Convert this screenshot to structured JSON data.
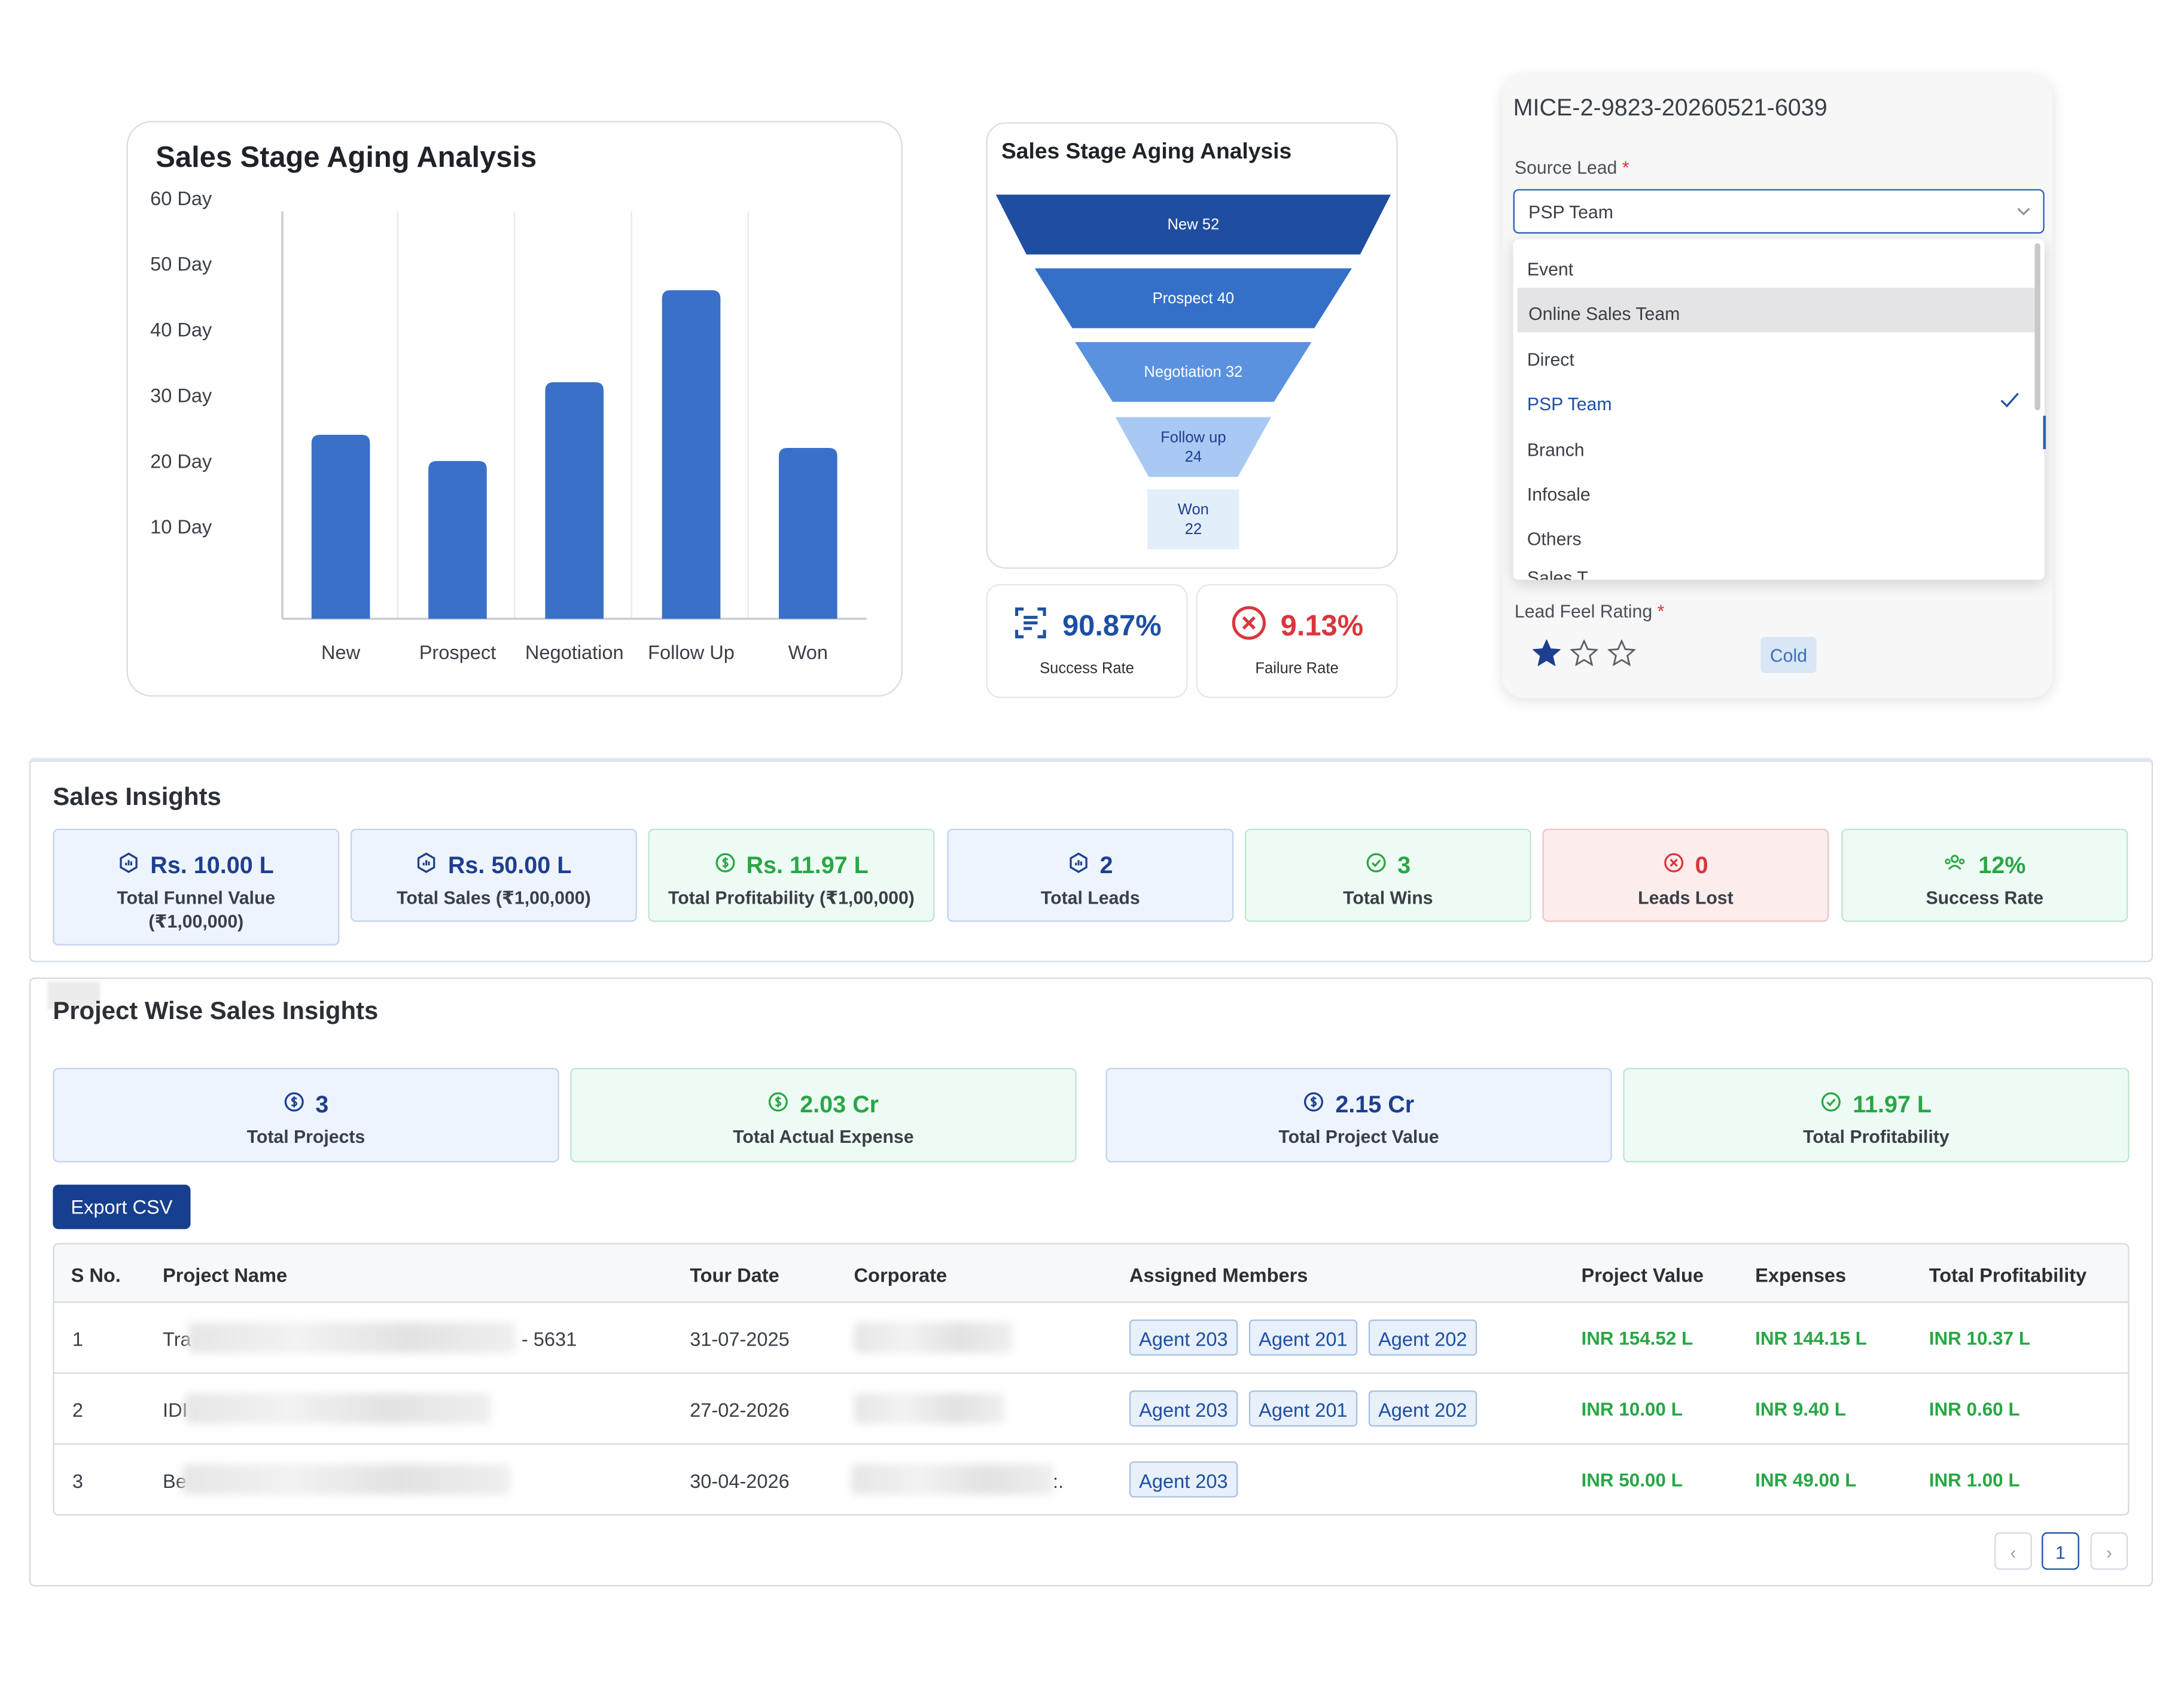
{
  "bar_chart": {
    "title": "Sales Stage Aging Analysis",
    "chart_data": {
      "type": "bar",
      "categories": [
        "New",
        "Prospect",
        "Negotiation",
        "Follow Up",
        "Won"
      ],
      "values": [
        28,
        24,
        36,
        50,
        26
      ],
      "ytick_labels": [
        "10 Day",
        "20 Day",
        "30 Day",
        "40 Day",
        "50 Day",
        "60 Day"
      ],
      "ylim": [
        0,
        62
      ],
      "grid": "vertical",
      "color": "#3a70c8"
    }
  },
  "funnel": {
    "title": "Sales Stage Aging Analysis",
    "chart_data": {
      "type": "funnel",
      "stages": [
        {
          "label": "New 52",
          "lines": [
            "New 52"
          ],
          "value": 52,
          "color": "#1f4ea0",
          "text_color": "#ffffff"
        },
        {
          "label": "Prospect 40",
          "lines": [
            "Prospect 40"
          ],
          "value": 40,
          "color": "#3470c8",
          "text_color": "#ffffff"
        },
        {
          "label": "Negotiation 32",
          "lines": [
            "Negotiation 32"
          ],
          "value": 32,
          "color": "#5b92e0",
          "text_color": "#ffffff"
        },
        {
          "label": "Follow up 24",
          "lines": [
            "Follow up",
            "24"
          ],
          "value": 24,
          "color": "#a9c9f4",
          "text_color": "#1d3f8f"
        },
        {
          "label": "Won 22",
          "lines": [
            "Won",
            "22"
          ],
          "value": 22,
          "color": "#e3eefb",
          "text_color": "#1d3f8f"
        }
      ]
    }
  },
  "rates": {
    "success": {
      "value": "90.87%",
      "label": "Success Rate",
      "icon": "document-list-icon",
      "color": "#1d4fa3"
    },
    "failure": {
      "value": "9.13%",
      "label": "Failure Rate",
      "icon": "x-circle-icon",
      "color": "#d9363e"
    }
  },
  "lead_form": {
    "lead_id": "MICE-2-9823-20260521-6039",
    "source_label": "Source Lead",
    "required_mark": "*",
    "selected": "PSP Team",
    "options": [
      "Event",
      "Online Sales Team",
      "Direct",
      "PSP Team",
      "Branch",
      "Infosale",
      "Others"
    ],
    "hovered_option": "Online Sales Team",
    "cut_option": "Sales T...",
    "rating_label": "Lead Feel Rating",
    "rating": 1,
    "rating_max": 3,
    "rating_badge": "Cold"
  },
  "sales_insights": {
    "title": "Sales Insights",
    "stats": [
      {
        "value": "Rs. 10.00 L",
        "label": "Total Funnel Value (₹1,00,000)",
        "icon": "hexagon-chart-icon",
        "tone": "blue"
      },
      {
        "value": "Rs. 50.00 L",
        "label": "Total Sales (₹1,00,000)",
        "icon": "hexagon-chart-icon",
        "tone": "blue"
      },
      {
        "value": "Rs. 11.97 L",
        "label": "Total Profitability (₹1,00,000)",
        "icon": "dollar-circle-icon",
        "tone": "green"
      },
      {
        "value": "2",
        "label": "Total Leads",
        "icon": "hexagon-chart-icon",
        "tone": "blue"
      },
      {
        "value": "3",
        "label": "Total Wins",
        "icon": "check-circle-icon",
        "tone": "green"
      },
      {
        "value": "0",
        "label": "Leads Lost",
        "icon": "x-circle-icon",
        "tone": "red"
      },
      {
        "value": "12%",
        "label": "Success Rate",
        "icon": "users-icon",
        "tone": "green"
      }
    ]
  },
  "project_insights": {
    "title": "Project Wise Sales Insights",
    "stats": [
      {
        "value": "3",
        "label": "Total Projects",
        "icon": "dollar-circle-icon",
        "tone": "blue"
      },
      {
        "value": "2.03 Cr",
        "label": "Total Actual Expense",
        "icon": "dollar-circle-icon",
        "tone": "green"
      },
      {
        "value": "2.15 Cr",
        "label": "Total Project Value",
        "icon": "dollar-circle-icon",
        "tone": "blue"
      },
      {
        "value": "11.97 L",
        "label": "Total Profitability",
        "icon": "check-circle-icon",
        "tone": "green"
      }
    ],
    "export_label": "Export CSV",
    "table": {
      "headers": [
        "S No.",
        "Project Name",
        "Tour Date",
        "Corporate",
        "Assigned Members",
        "Project Value",
        "Expenses",
        "Total Profitability"
      ],
      "rows": [
        {
          "sno": "1",
          "name_prefix": "Tra",
          "name_suffix": "- 5631",
          "tour_date": "31-07-2025",
          "corporate_suffix": "",
          "members": [
            "Agent 203",
            "Agent 201",
            "Agent 202"
          ],
          "value": "INR 154.52 L",
          "expenses": "INR 144.15 L",
          "profit": "INR 10.37 L"
        },
        {
          "sno": "2",
          "name_prefix": "IDI",
          "name_suffix": "",
          "tour_date": "27-02-2026",
          "corporate_suffix": "",
          "members": [
            "Agent 203",
            "Agent 201",
            "Agent 202"
          ],
          "value": "INR 10.00 L",
          "expenses": "INR 9.40 L",
          "profit": "INR 0.60 L"
        },
        {
          "sno": "3",
          "name_prefix": "Be",
          "name_suffix": "",
          "tour_date": "30-04-2026",
          "corporate_suffix": ":.",
          "members": [
            "Agent 203"
          ],
          "value": "INR 50.00 L",
          "expenses": "INR 49.00 L",
          "profit": "INR 1.00 L"
        }
      ]
    },
    "pagination": {
      "prev": "‹",
      "current": "1",
      "next": "›"
    }
  },
  "colors": {
    "brand_blue": "#1d3f8f",
    "success_green": "#28a745",
    "danger_red": "#d9363e",
    "bar_blue": "#3a70c8"
  }
}
